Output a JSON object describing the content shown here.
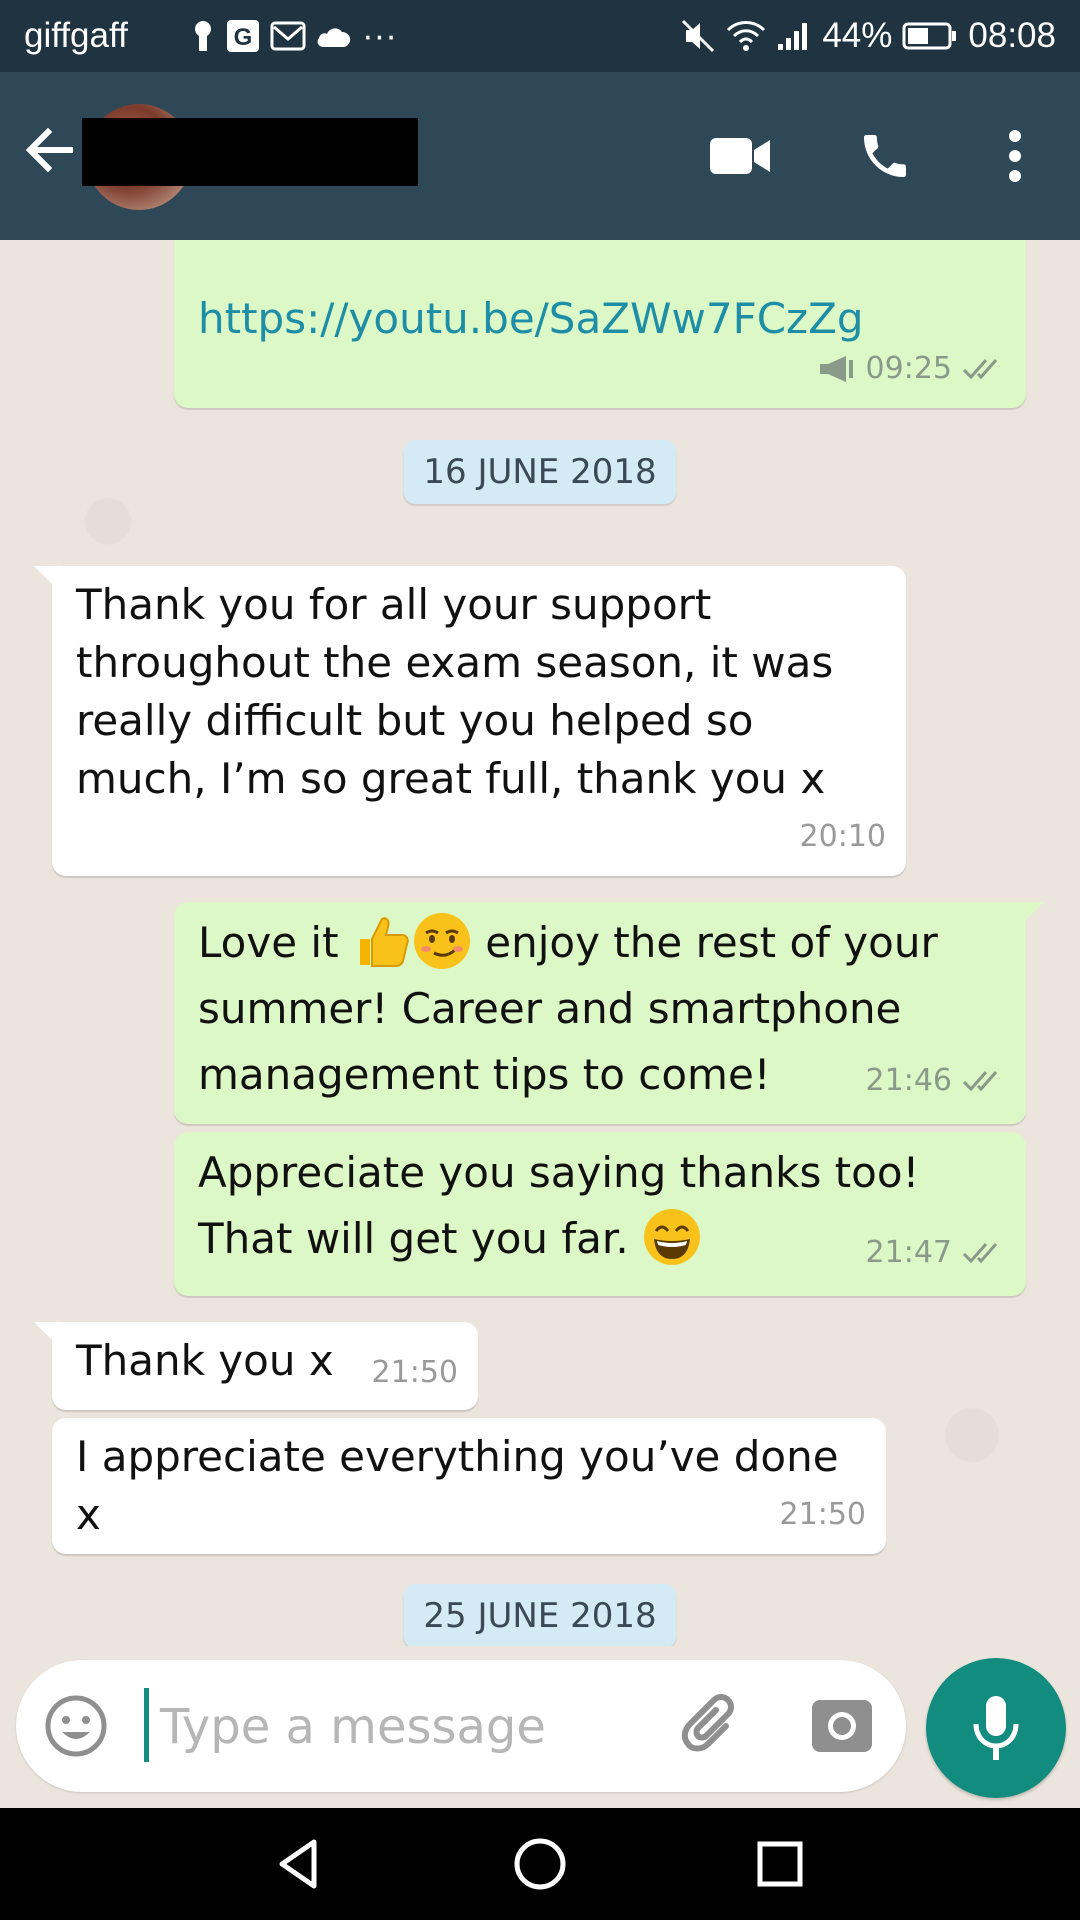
{
  "status_bar": {
    "carrier": "giffgaff",
    "battery_percent": "44%",
    "time": "08:08",
    "more_indicator": "···"
  },
  "app_bar": {
    "contact_name": "",
    "icons": [
      "back-arrow-icon",
      "video-call-icon",
      "voice-call-icon",
      "more-vert-icon"
    ]
  },
  "messages": [
    {
      "type": "out",
      "text": "https://youtu.be/SaZWw7FCzZg",
      "time": "09:25",
      "status": "read",
      "is_link": true
    },
    {
      "type": "date",
      "text": "16 JUNE 2018"
    },
    {
      "type": "in",
      "lines": [
        "Thank you for all your support",
        "throughout the exam season, it was",
        "really difficult but you helped so",
        "much, I’m so great full, thank you x"
      ],
      "time": "20:10"
    },
    {
      "type": "out",
      "text_before_emoji": "Love it",
      "emojis": [
        "thumbs-up",
        "smirk"
      ],
      "text_after_emoji": "enjoy the rest of your",
      "line2": "summer! Career and smartphone",
      "line3": "management tips to come!",
      "time": "21:46",
      "status": "read"
    },
    {
      "type": "out",
      "line1": "Appreciate you saying thanks too!",
      "line2": "That will get you far.",
      "emoji": "grinning",
      "time": "21:47",
      "status": "read"
    },
    {
      "type": "in",
      "text": "Thank you x",
      "time": "21:50"
    },
    {
      "type": "in",
      "text": "I appreciate everything you’ve done x",
      "time": "21:50"
    },
    {
      "type": "date",
      "text": "25 JUNE 2018"
    }
  ],
  "input": {
    "placeholder": "Type a message"
  },
  "colors": {
    "header": "#2f4858",
    "status_bar": "#1f3341",
    "outgoing_bubble": "#dcf8c6",
    "incoming_bubble": "#ffffff",
    "accent": "#128c7e",
    "link": "#1e8ea6",
    "date_pill": "#d4eaf4"
  }
}
